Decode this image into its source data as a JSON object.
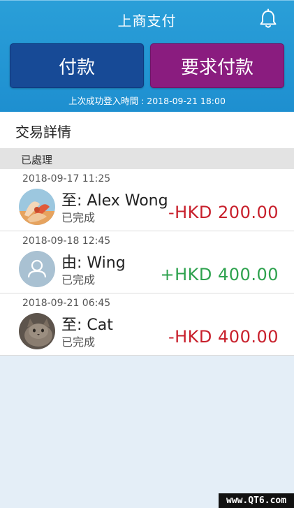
{
  "header": {
    "title": "上商支付",
    "bell_icon": "bell-icon"
  },
  "actions": {
    "pay_label": "付款",
    "request_label": "要求付款",
    "pay_color": "#174a96",
    "request_color": "#8a1c7f"
  },
  "last_login": "上次成功登入時間 : 2018-09-21 18:00",
  "section": {
    "title": "交易詳情",
    "group_label": "已處理"
  },
  "transactions": [
    {
      "datetime": "2018-09-17 11:25",
      "party": "至: Alex Wong",
      "status": "已完成",
      "amount": "-HKD 200.00",
      "avatar_icon": "flower-photo-icon"
    },
    {
      "datetime": "2018-09-18 12:45",
      "party": "由: Wing",
      "status": "已完成",
      "amount": "+HKD 400.00",
      "avatar_icon": "user-placeholder-icon"
    },
    {
      "datetime": "2018-09-21 06:45",
      "party": "至: Cat",
      "status": "已完成",
      "amount": "-HKD 400.00",
      "avatar_icon": "cat-photo-icon"
    }
  ],
  "colors": {
    "header_blue": "#1e8fd0",
    "negative": "#c8202c",
    "positive": "#2ea24e"
  },
  "watermark": "www.QT6.com"
}
